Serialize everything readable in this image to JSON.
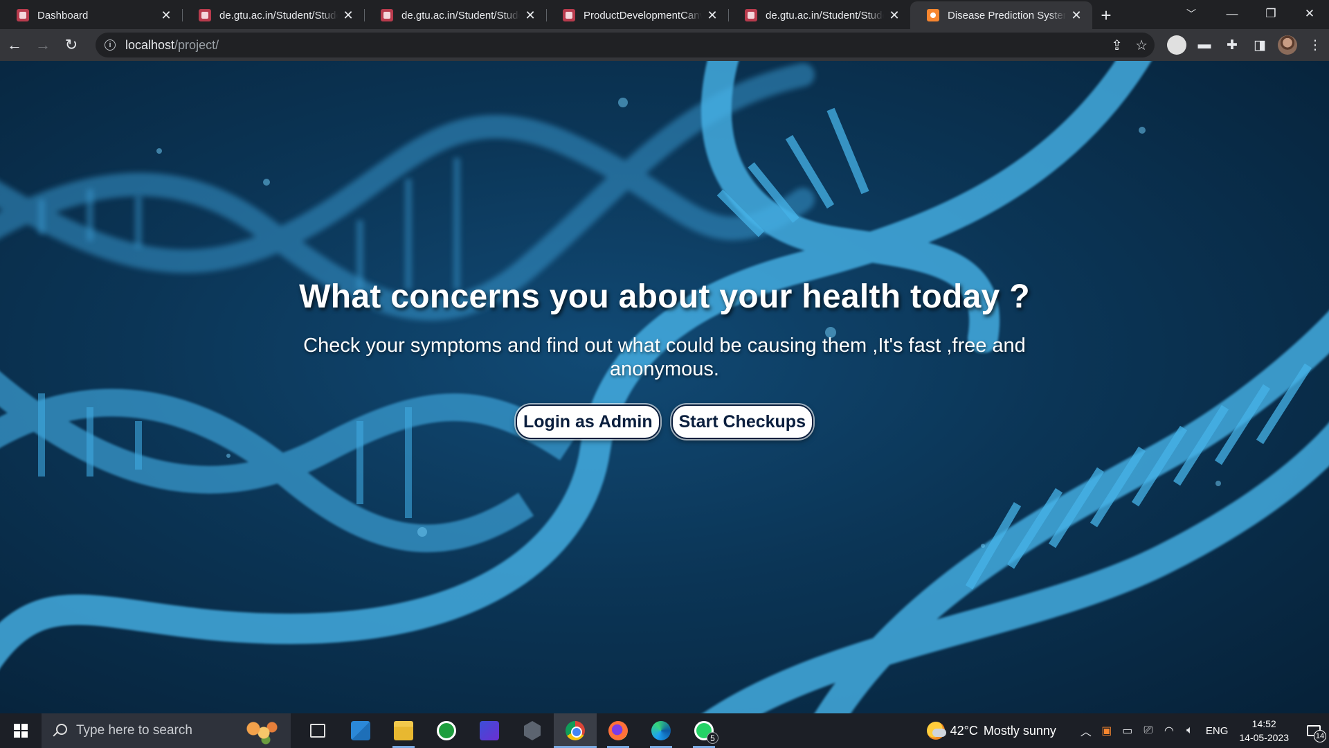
{
  "browser": {
    "tabs": [
      {
        "title": "Dashboard",
        "active": false
      },
      {
        "title": "de.gtu.ac.in/Student/Studen",
        "active": false
      },
      {
        "title": "de.gtu.ac.in/Student/Studen",
        "active": false
      },
      {
        "title": "ProductDevelopmentCanva",
        "active": false
      },
      {
        "title": "de.gtu.ac.in/Student/Studen",
        "active": false
      },
      {
        "title": "Disease Prediction System",
        "active": true
      }
    ],
    "close_glyph": "✕",
    "new_tab_glyph": "+",
    "url_host": "localhost",
    "url_path": "/project/"
  },
  "page": {
    "heading": "What concerns you about your health today ?",
    "subheading": "Check your symptoms and find out what could be causing them ,It's fast ,free and anonymous.",
    "login_button": "Login as Admin",
    "checkup_button": "Start Checkups"
  },
  "taskbar": {
    "search_placeholder": "Type here to search",
    "whatsapp_badge": "5",
    "weather_temp": "42°C",
    "weather_text": "Mostly sunny",
    "language": "ENG",
    "time": "14:52",
    "date": "14-05-2023",
    "notification_count": "14"
  },
  "colors": {
    "page_bg": "#0b3556",
    "dna": "#3fa9e0",
    "button_text": "#0a1e3d",
    "chrome_dark": "#202124",
    "chrome_toolbar": "#35363a"
  }
}
